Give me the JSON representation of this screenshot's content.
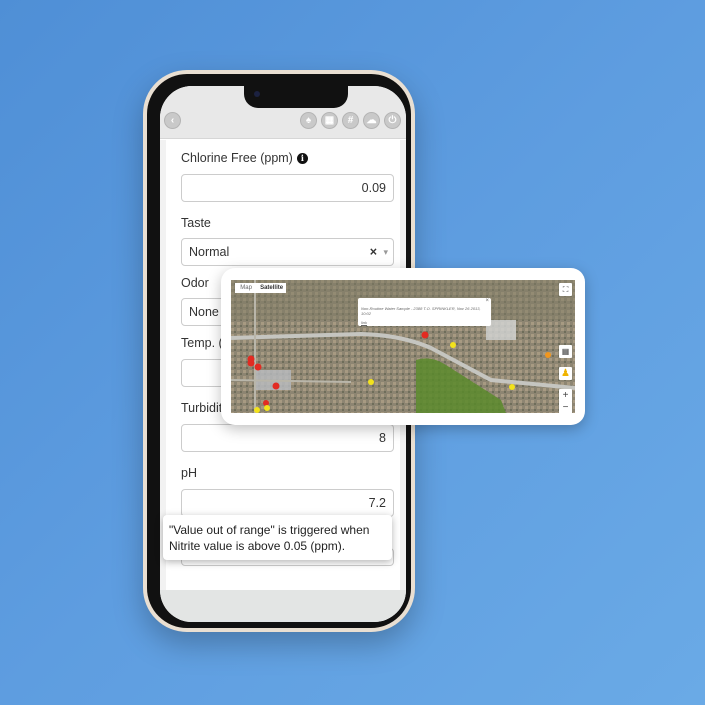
{
  "header": {
    "icons": [
      "back-icon",
      "bell-icon",
      "calendar-icon",
      "grid-icon",
      "cloud-icon",
      "power-icon"
    ]
  },
  "form": {
    "chlorine": {
      "label": "Chlorine Free (ppm)",
      "value": "0.09"
    },
    "taste": {
      "label": "Taste",
      "value": "Normal",
      "clear": "×",
      "caret": "▾"
    },
    "odor": {
      "label": "Odor",
      "value": "None"
    },
    "temp": {
      "label": "Temp. (°C)",
      "value": ""
    },
    "turbidity": {
      "label": "Turbidity (N",
      "value": "8"
    },
    "ph": {
      "label": "pH",
      "value": "7.2"
    }
  },
  "tooltip": {
    "text": "\"Value out of range\" is triggered when Nitrite value is above 0.05 (ppm)."
  },
  "map": {
    "tabs": [
      "Map",
      "Satellite"
    ],
    "active_tab": "Satellite",
    "popup_text": "Non-Routine Water Sample - 2388 T.O. SPRINKLER, Nov 26 2013, 10:02",
    "popup_link": "link",
    "popup_close": "×",
    "zoom_in": "+",
    "zoom_out": "−",
    "marker_colors": {
      "red": "#e22b22",
      "yellow": "#f2e21c",
      "orange": "#f0961e"
    }
  }
}
